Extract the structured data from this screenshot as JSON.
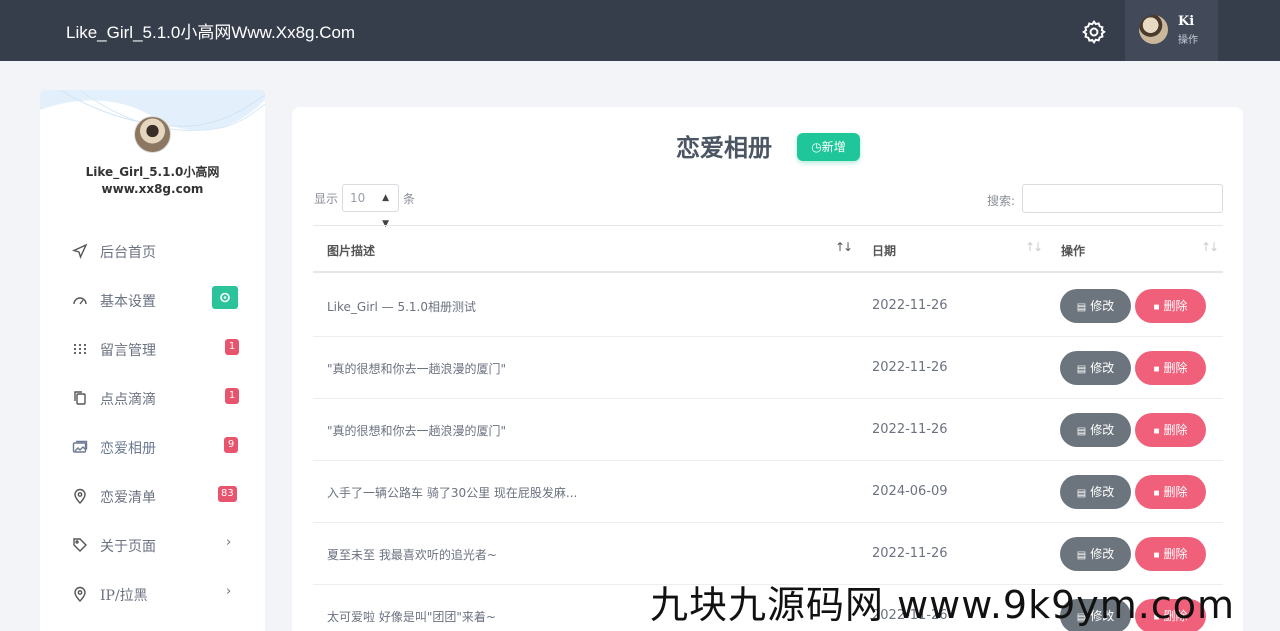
{
  "header": {
    "brand": "Like_Girl_5.1.0小高网Www.Xx8g.Com",
    "settings_icon": "gear-icon",
    "user": {
      "name": "Ki",
      "role": "操作"
    }
  },
  "sidebar": {
    "site_title": "Like_Girl_5.1.0小高网",
    "site_sub": "www.xx8g.com",
    "items": [
      {
        "label": "后台首页",
        "icon": "paper-plane-icon"
      },
      {
        "label": "基本设置",
        "icon": "gauge-icon",
        "badge_icon": "settings-icon"
      },
      {
        "label": "留言管理",
        "icon": "grid-dots-icon",
        "badge": "1"
      },
      {
        "label": "点点滴滴",
        "icon": "copy-icon",
        "badge": "1"
      },
      {
        "label": "恋爱相册",
        "icon": "photo-icon",
        "badge": "9"
      },
      {
        "label": "恋爱清单",
        "icon": "location-pin-icon",
        "badge": "83"
      },
      {
        "label": "关于页面",
        "icon": "tag-icon",
        "chevron": "›"
      },
      {
        "label": "IP/拉黑",
        "icon": "location-pin-icon",
        "chevron": "›"
      }
    ]
  },
  "main": {
    "title": "恋爱相册",
    "add_label": "新增",
    "length": {
      "prefix": "显示",
      "value": "10",
      "suffix": "条"
    },
    "search_label": "搜索:",
    "columns": [
      "图片描述",
      "日期",
      "操作"
    ],
    "rows": [
      {
        "desc": "Like_Girl — 5.1.0相册测试",
        "date": "2022-11-26"
      },
      {
        "desc": "\"真的很想和你去一趟浪漫的厦门\"",
        "date": "2022-11-26"
      },
      {
        "desc": "\"真的很想和你去一趟浪漫的厦门\"",
        "date": "2022-11-26"
      },
      {
        "desc": "入手了一辆公路车 骑了30公里 现在屁股发麻...",
        "date": "2024-06-09"
      },
      {
        "desc": "夏至未至 我最喜欢听的追光者~",
        "date": "2022-11-26"
      },
      {
        "desc": "太可爱啦 好像是叫\"团团\"来着~",
        "date": "2022-11-26"
      }
    ],
    "edit_label": "修改",
    "delete_label": "删除"
  },
  "watermark": "九块九源码网 www.9k9ym.com",
  "colors": {
    "topbar": "#363d4b",
    "accent_green": "#1fc699",
    "badge_red": "#e8546e",
    "edit_gray": "#6c757d",
    "delete_pink": "#f0607a"
  }
}
